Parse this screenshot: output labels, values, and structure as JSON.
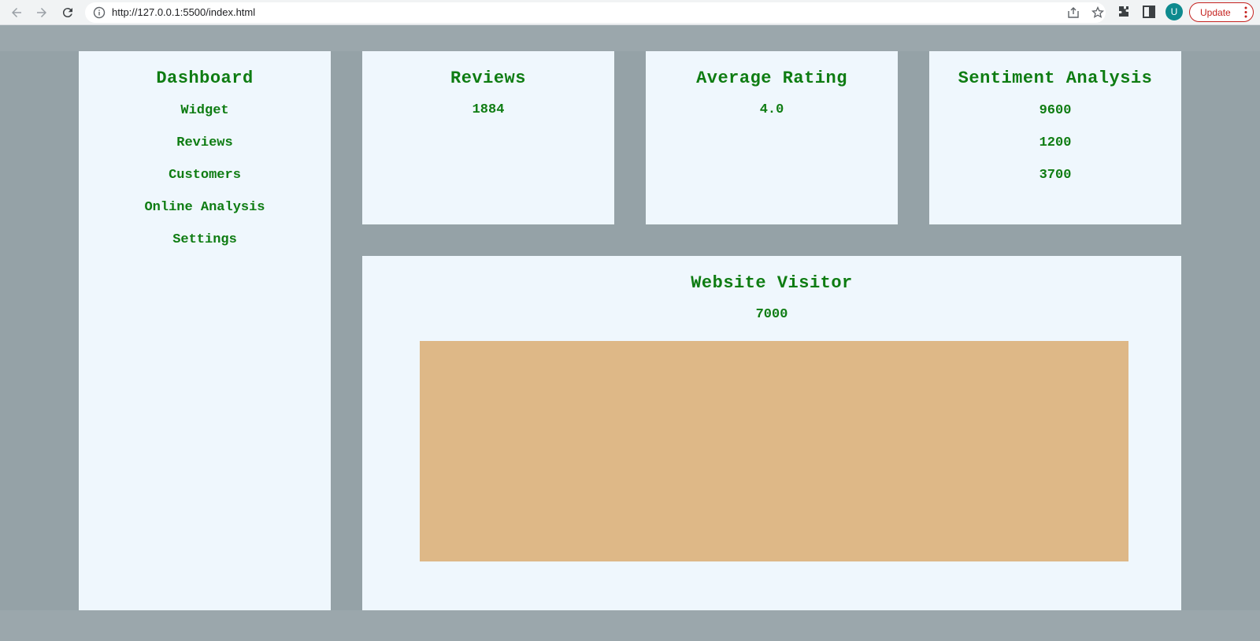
{
  "browser": {
    "url": "http://127.0.0.1:5500/index.html",
    "avatar_letter": "U",
    "update_label": "Update"
  },
  "sidebar": {
    "title": "Dashboard",
    "items": [
      {
        "label": "Widget"
      },
      {
        "label": "Reviews"
      },
      {
        "label": "Customers"
      },
      {
        "label": "Online Analysis"
      },
      {
        "label": "Settings"
      }
    ]
  },
  "cards": {
    "reviews": {
      "title": "Reviews",
      "value": "1884"
    },
    "rating": {
      "title": "Average Rating",
      "value": "4.0"
    },
    "sentiment": {
      "title": "Sentiment Analysis",
      "values": [
        "9600",
        "1200",
        "3700"
      ]
    },
    "visitor": {
      "title": "Website Visitor",
      "value": "7000"
    }
  },
  "colors": {
    "text": "#0e7c12",
    "panel_bg": "#eff7fd",
    "page_bg": "#95a2a7",
    "visitor_box": "#deb887"
  }
}
